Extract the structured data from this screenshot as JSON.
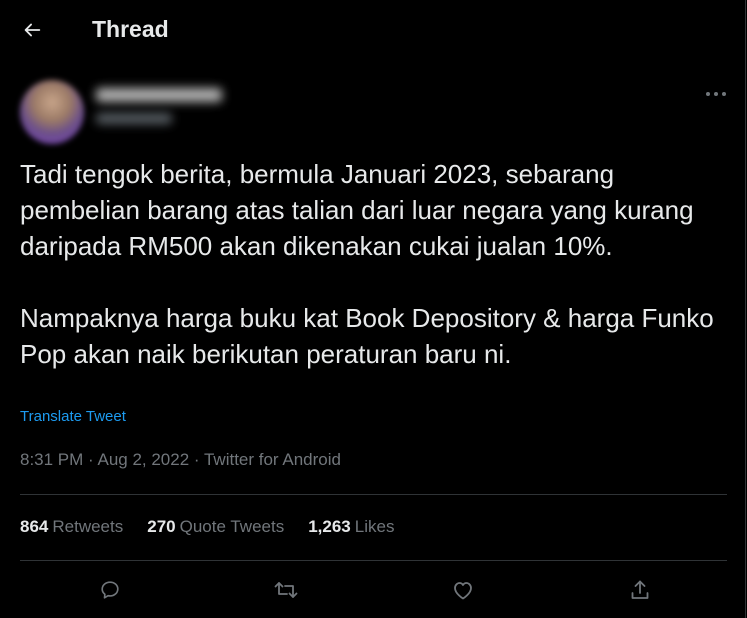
{
  "header": {
    "title": "Thread",
    "back_icon": "arrow-left-icon"
  },
  "tweet": {
    "text": "Tadi tengok berita, bermula Januari 2023, sebarang pembelian barang atas talian dari luar negara yang kurang daripada RM500 akan dikenakan cukai jualan 10%.\n\nNampaknya harga buku kat Book Depository & harga Funko Pop akan naik berikutan peraturan baru ni.",
    "translate_label": "Translate Tweet",
    "meta": "8:31 PM · Aug 2, 2022 · Twitter for Android"
  },
  "stats": {
    "retweets": {
      "count": "864",
      "label": "Retweets"
    },
    "quote_tweets": {
      "count": "270",
      "label": "Quote Tweets"
    },
    "likes": {
      "count": "1,263",
      "label": "Likes"
    }
  },
  "actions": [
    "reply-icon",
    "retweet-icon",
    "like-icon",
    "share-icon"
  ],
  "colors": {
    "background": "#000000",
    "text": "#e7e9ea",
    "muted": "#71767b",
    "link": "#1d9bf0",
    "border": "#2f3336"
  }
}
